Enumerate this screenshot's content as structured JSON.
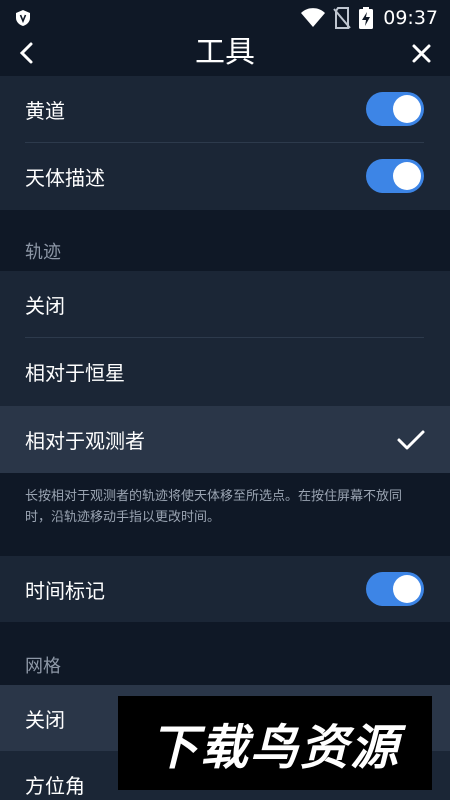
{
  "status_bar": {
    "time": "09:37",
    "icons": [
      "shield-icon",
      "wifi-icon",
      "no-sim-icon",
      "battery-charging-icon"
    ]
  },
  "header": {
    "title": "工具",
    "back_icon": "chevron-left-icon",
    "close_icon": "close-icon"
  },
  "display_toggles": [
    {
      "label": "黄道",
      "enabled": true
    },
    {
      "label": "天体描述",
      "enabled": true
    }
  ],
  "trajectory": {
    "section_label": "轨迹",
    "options": [
      {
        "label": "关闭",
        "selected": false
      },
      {
        "label": "相对于恒星",
        "selected": false
      },
      {
        "label": "相对于观测者",
        "selected": true
      }
    ],
    "note": "长按相对于观测者的轨迹将使天体移至所选点。在按住屏幕不放同时，沿轨迹移动手指以更改时间。"
  },
  "time_marker": {
    "label": "时间标记",
    "enabled": true
  },
  "grid": {
    "section_label": "网格",
    "options": [
      {
        "label": "关闭",
        "selected": true
      },
      {
        "label": "方位角",
        "selected": false
      }
    ]
  },
  "watermark": {
    "text": "下载鸟资源"
  },
  "colors": {
    "background": "#0f1826",
    "card": "#1b2636",
    "selected": "#2a3648",
    "accent": "#3d85e6"
  }
}
